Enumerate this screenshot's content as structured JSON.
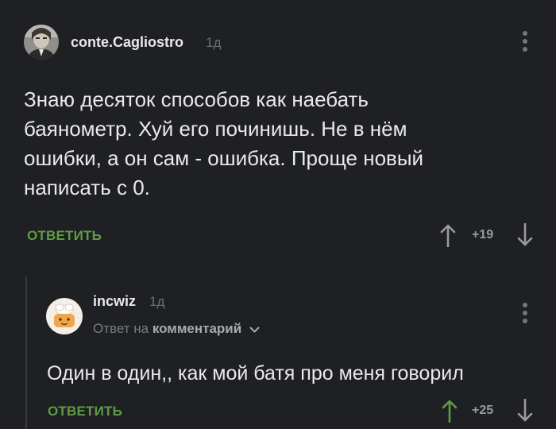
{
  "comment": {
    "author": "conte.Cagliostro",
    "time": "1д",
    "lines": [
      "Знаю десяток способов как наебать",
      "баянометр. Хуй его починишь. Не в нём",
      "ошибки, а он сам - ошибка. Проще новый",
      "написать с 0."
    ],
    "reply_label": "ОТВЕТИТЬ",
    "score": "+19"
  },
  "reply": {
    "author": "incwiz",
    "time": "1д",
    "reply_to_prefix": "Ответ на",
    "reply_to_target": "комментарий",
    "text": "Один в один,, как мой батя про меня говорил",
    "reply_label": "ОТВЕТИТЬ",
    "score": "+25"
  },
  "colors": {
    "background": "#1f2023",
    "accent_green": "#5f9c45",
    "text": "#e9e9e9",
    "muted": "#6e6f73"
  }
}
